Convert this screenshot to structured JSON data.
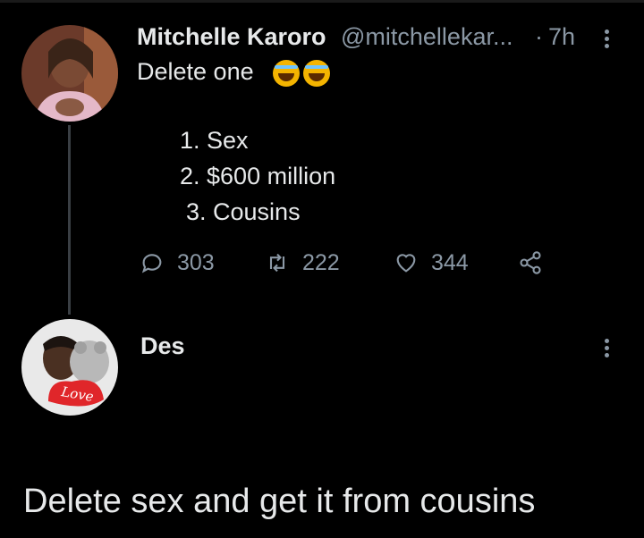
{
  "tweet": {
    "author_name": "Mitchelle Karoro",
    "author_handle": "@mitchellekar...",
    "separator": "·",
    "time": "7h",
    "text": "Delete one",
    "emoji": [
      "laughing-crying-emoji",
      "laughing-crying-emoji"
    ],
    "list": [
      "1. Sex",
      "2. $600 million",
      "3. Cousins"
    ],
    "actions": {
      "replies": "303",
      "retweets": "222",
      "likes": "344"
    }
  },
  "reply": {
    "author_name": "Des",
    "text": "Delete sex and get it from cousins",
    "avatar_caption": "Love"
  },
  "colors": {
    "background": "#000000",
    "text": "#e7e9ea",
    "muted": "#8b98a5",
    "thread_line": "#3a3f44"
  }
}
